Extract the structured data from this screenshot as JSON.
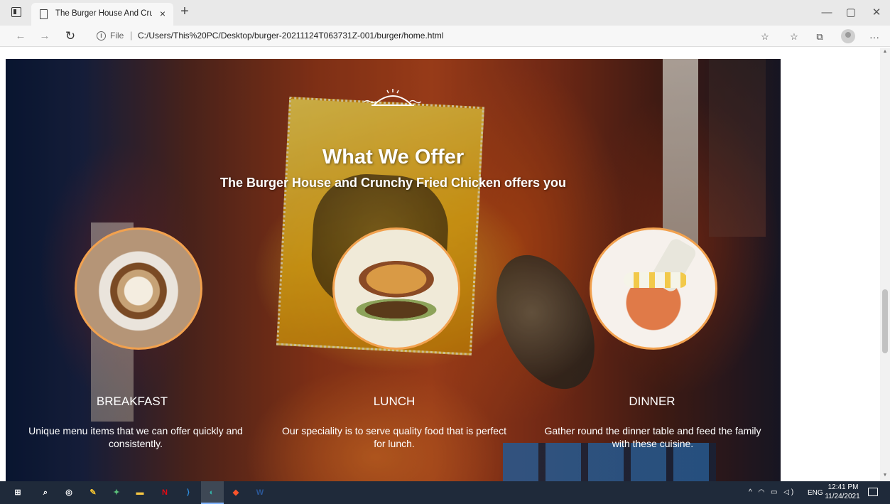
{
  "browser": {
    "tab": {
      "title": "The Burger House And Crunchy F",
      "close_label": "×"
    },
    "new_tab_label": "+",
    "window_controls": {
      "minimize": "—",
      "maximize": "▢",
      "close": "✕"
    },
    "nav": {
      "back": "←",
      "forward": "→",
      "refresh": "↻"
    },
    "address": {
      "info_icon": "i",
      "scheme_label": "File",
      "separator": "|",
      "url": "C:/Users/This%20PC/Desktop/burger-20211124T063731Z-001/burger/home.html"
    },
    "toolbar": {
      "add_favorite": "☆",
      "favorites": "☆",
      "collections": "⧉",
      "more": "···"
    }
  },
  "page": {
    "heading": "What We Offer",
    "subheading": "The Burger House and Crunchy Fried Chicken offers you",
    "meals": [
      {
        "name": "BREAKFAST",
        "description": "Unique menu items that we can offer quickly and consistently.",
        "icon": "coffee-latte-image"
      },
      {
        "name": "LUNCH",
        "description": "Our speciality is to serve quality food that is perfect for lunch.",
        "icon": "burger-image"
      },
      {
        "name": "DINNER",
        "description": "Gather round the dinner table and feed the family with these cuisine.",
        "icon": "fried-rice-image"
      }
    ],
    "accent_color": "#f2a14e"
  },
  "taskbar": {
    "apps": [
      {
        "name": "start",
        "glyph": "⊞",
        "color": "#ffffff"
      },
      {
        "name": "search",
        "glyph": "⌕",
        "color": "#ffffff"
      },
      {
        "name": "chrome",
        "glyph": "◎",
        "color": "#ffffff"
      },
      {
        "name": "app-a",
        "glyph": "✎",
        "color": "#f2c230"
      },
      {
        "name": "app-b",
        "glyph": "✦",
        "color": "#5bc07a"
      },
      {
        "name": "file-explorer",
        "glyph": "▬",
        "color": "#f5c542"
      },
      {
        "name": "netflix",
        "glyph": "N",
        "color": "#e50914"
      },
      {
        "name": "vscode",
        "glyph": "⟩",
        "color": "#2f8fe0"
      },
      {
        "name": "edge",
        "glyph": "◐",
        "color": "#35b3a8"
      },
      {
        "name": "brave",
        "glyph": "◆",
        "color": "#fb542b"
      },
      {
        "name": "word",
        "glyph": "W",
        "color": "#2b5797"
      }
    ],
    "tray": {
      "icons": "^ ◠ ▭ ◁)",
      "language": "ENG",
      "time": "12:41 PM",
      "date": "11/24/2021"
    }
  }
}
